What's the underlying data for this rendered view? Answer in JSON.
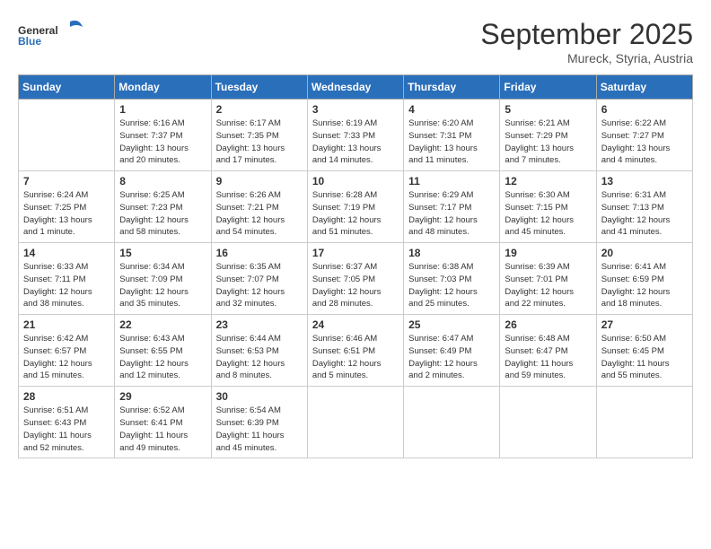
{
  "logo": {
    "general": "General",
    "blue": "Blue"
  },
  "title": "September 2025",
  "location": "Mureck, Styria, Austria",
  "days_of_week": [
    "Sunday",
    "Monday",
    "Tuesday",
    "Wednesday",
    "Thursday",
    "Friday",
    "Saturday"
  ],
  "weeks": [
    [
      {
        "day": "",
        "info": ""
      },
      {
        "day": "1",
        "info": "Sunrise: 6:16 AM\nSunset: 7:37 PM\nDaylight: 13 hours\nand 20 minutes."
      },
      {
        "day": "2",
        "info": "Sunrise: 6:17 AM\nSunset: 7:35 PM\nDaylight: 13 hours\nand 17 minutes."
      },
      {
        "day": "3",
        "info": "Sunrise: 6:19 AM\nSunset: 7:33 PM\nDaylight: 13 hours\nand 14 minutes."
      },
      {
        "day": "4",
        "info": "Sunrise: 6:20 AM\nSunset: 7:31 PM\nDaylight: 13 hours\nand 11 minutes."
      },
      {
        "day": "5",
        "info": "Sunrise: 6:21 AM\nSunset: 7:29 PM\nDaylight: 13 hours\nand 7 minutes."
      },
      {
        "day": "6",
        "info": "Sunrise: 6:22 AM\nSunset: 7:27 PM\nDaylight: 13 hours\nand 4 minutes."
      }
    ],
    [
      {
        "day": "7",
        "info": "Sunrise: 6:24 AM\nSunset: 7:25 PM\nDaylight: 13 hours\nand 1 minute."
      },
      {
        "day": "8",
        "info": "Sunrise: 6:25 AM\nSunset: 7:23 PM\nDaylight: 12 hours\nand 58 minutes."
      },
      {
        "day": "9",
        "info": "Sunrise: 6:26 AM\nSunset: 7:21 PM\nDaylight: 12 hours\nand 54 minutes."
      },
      {
        "day": "10",
        "info": "Sunrise: 6:28 AM\nSunset: 7:19 PM\nDaylight: 12 hours\nand 51 minutes."
      },
      {
        "day": "11",
        "info": "Sunrise: 6:29 AM\nSunset: 7:17 PM\nDaylight: 12 hours\nand 48 minutes."
      },
      {
        "day": "12",
        "info": "Sunrise: 6:30 AM\nSunset: 7:15 PM\nDaylight: 12 hours\nand 45 minutes."
      },
      {
        "day": "13",
        "info": "Sunrise: 6:31 AM\nSunset: 7:13 PM\nDaylight: 12 hours\nand 41 minutes."
      }
    ],
    [
      {
        "day": "14",
        "info": "Sunrise: 6:33 AM\nSunset: 7:11 PM\nDaylight: 12 hours\nand 38 minutes."
      },
      {
        "day": "15",
        "info": "Sunrise: 6:34 AM\nSunset: 7:09 PM\nDaylight: 12 hours\nand 35 minutes."
      },
      {
        "day": "16",
        "info": "Sunrise: 6:35 AM\nSunset: 7:07 PM\nDaylight: 12 hours\nand 32 minutes."
      },
      {
        "day": "17",
        "info": "Sunrise: 6:37 AM\nSunset: 7:05 PM\nDaylight: 12 hours\nand 28 minutes."
      },
      {
        "day": "18",
        "info": "Sunrise: 6:38 AM\nSunset: 7:03 PM\nDaylight: 12 hours\nand 25 minutes."
      },
      {
        "day": "19",
        "info": "Sunrise: 6:39 AM\nSunset: 7:01 PM\nDaylight: 12 hours\nand 22 minutes."
      },
      {
        "day": "20",
        "info": "Sunrise: 6:41 AM\nSunset: 6:59 PM\nDaylight: 12 hours\nand 18 minutes."
      }
    ],
    [
      {
        "day": "21",
        "info": "Sunrise: 6:42 AM\nSunset: 6:57 PM\nDaylight: 12 hours\nand 15 minutes."
      },
      {
        "day": "22",
        "info": "Sunrise: 6:43 AM\nSunset: 6:55 PM\nDaylight: 12 hours\nand 12 minutes."
      },
      {
        "day": "23",
        "info": "Sunrise: 6:44 AM\nSunset: 6:53 PM\nDaylight: 12 hours\nand 8 minutes."
      },
      {
        "day": "24",
        "info": "Sunrise: 6:46 AM\nSunset: 6:51 PM\nDaylight: 12 hours\nand 5 minutes."
      },
      {
        "day": "25",
        "info": "Sunrise: 6:47 AM\nSunset: 6:49 PM\nDaylight: 12 hours\nand 2 minutes."
      },
      {
        "day": "26",
        "info": "Sunrise: 6:48 AM\nSunset: 6:47 PM\nDaylight: 11 hours\nand 59 minutes."
      },
      {
        "day": "27",
        "info": "Sunrise: 6:50 AM\nSunset: 6:45 PM\nDaylight: 11 hours\nand 55 minutes."
      }
    ],
    [
      {
        "day": "28",
        "info": "Sunrise: 6:51 AM\nSunset: 6:43 PM\nDaylight: 11 hours\nand 52 minutes."
      },
      {
        "day": "29",
        "info": "Sunrise: 6:52 AM\nSunset: 6:41 PM\nDaylight: 11 hours\nand 49 minutes."
      },
      {
        "day": "30",
        "info": "Sunrise: 6:54 AM\nSunset: 6:39 PM\nDaylight: 11 hours\nand 45 minutes."
      },
      {
        "day": "",
        "info": ""
      },
      {
        "day": "",
        "info": ""
      },
      {
        "day": "",
        "info": ""
      },
      {
        "day": "",
        "info": ""
      }
    ]
  ]
}
